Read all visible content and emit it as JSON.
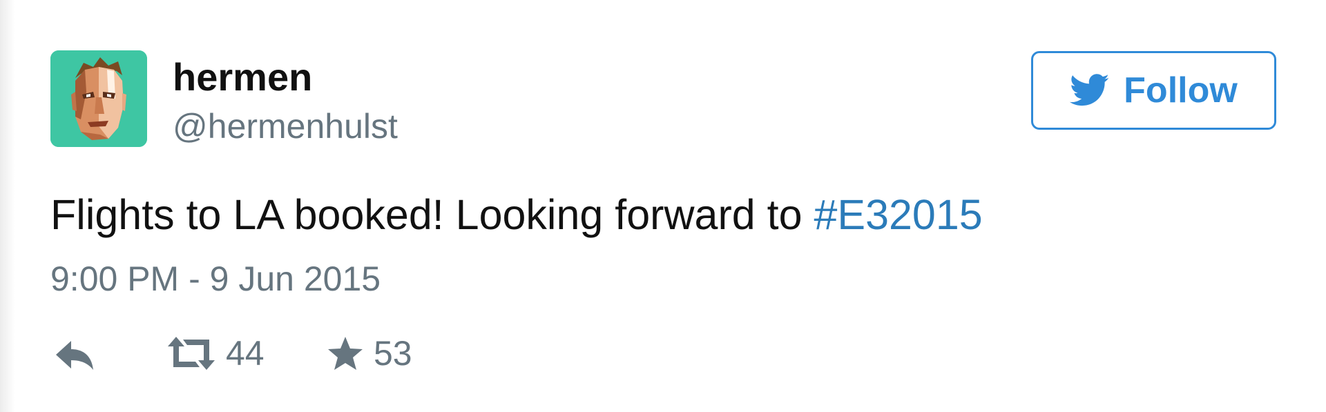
{
  "colors": {
    "accent": "#2f8ad8",
    "hashtag": "#2b7bb9",
    "muted_text": "#66757f",
    "primary_text": "#111111",
    "avatar_bg": "#3ec6a3"
  },
  "user": {
    "name": "hermen",
    "handle": "@hermenhulst",
    "avatar_icon": "avatar-face-icon"
  },
  "follow": {
    "label": "Follow",
    "icon": "twitter-bird-icon"
  },
  "tweet": {
    "text_prefix": "Flights to LA booked! Looking forward to ",
    "hashtag": "#E32015",
    "timestamp": "9:00 PM - 9 Jun 2015"
  },
  "actions": {
    "reply_icon": "reply-icon",
    "retweet_icon": "retweet-icon",
    "retweet_count": "44",
    "favorite_icon": "star-icon",
    "favorite_count": "53"
  }
}
